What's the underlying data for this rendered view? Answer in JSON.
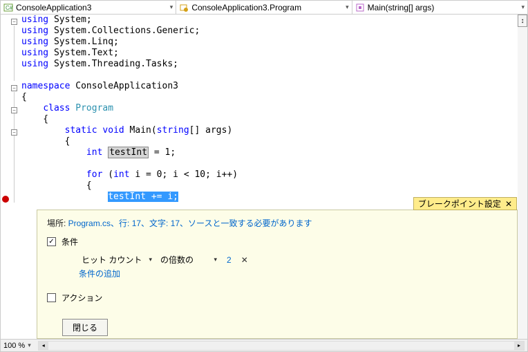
{
  "nav": {
    "project": "ConsoleApplication3",
    "class": "ConsoleApplication3.Program",
    "method": "Main(string[] args)"
  },
  "code": {
    "usings": [
      {
        "kw": "using",
        "ns": "System;"
      },
      {
        "kw": "using",
        "ns": "System.Collections.Generic;"
      },
      {
        "kw": "using",
        "ns": "System.Linq;"
      },
      {
        "kw": "using",
        "ns": "System.Text;"
      },
      {
        "kw": "using",
        "ns": "System.Threading.Tasks;"
      }
    ],
    "namespace_kw": "namespace",
    "namespace_name": "ConsoleApplication3",
    "class_kw": "class",
    "class_name": "Program",
    "method_sig": {
      "static": "static",
      "void": "void",
      "name": "Main(",
      "ptype": "string",
      "prest": "[] args)"
    },
    "decl": {
      "int": "int",
      "var": "testInt",
      "rest": " = 1;"
    },
    "for": {
      "for": "for",
      "open": " (",
      "int": "int",
      "cond": " i = 0; i < 10; i++)"
    },
    "bp_line": {
      "sel": "testInt",
      "rest": " += i;"
    }
  },
  "panel": {
    "title": "ブレークポイント設定",
    "loc_label": "場所: ",
    "loc_detail": "Program.cs、行: 17、文字: 17、ソースと一致する必要があります",
    "conditions_label": "条件",
    "hitcount_label": "ヒット カウント",
    "multiple_label": "の倍数の",
    "hitcount_value": "2",
    "add_condition": "条件の追加",
    "actions_label": "アクション",
    "close_btn": "閉じる"
  },
  "status": {
    "zoom": "100 %"
  }
}
